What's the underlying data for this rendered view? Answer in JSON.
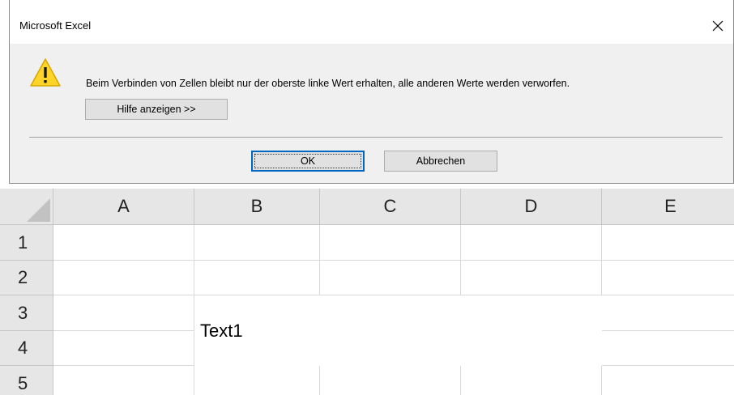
{
  "dialog": {
    "title": "Microsoft Excel",
    "close_glyph": "✕",
    "icon": "warning-icon",
    "message": "Beim Verbinden von Zellen bleibt nur der oberste linke Wert erhalten, alle anderen Werte werden verworfen.",
    "help_button": "Hilfe anzeigen >>",
    "ok_button": "OK",
    "cancel_button": "Abbrechen"
  },
  "sheet": {
    "columns": [
      "A",
      "B",
      "C",
      "D",
      "E"
    ],
    "rows": [
      "1",
      "2",
      "3",
      "4",
      "5"
    ],
    "merged_cell": {
      "range": "B3:D4",
      "value": "Text1"
    }
  }
}
